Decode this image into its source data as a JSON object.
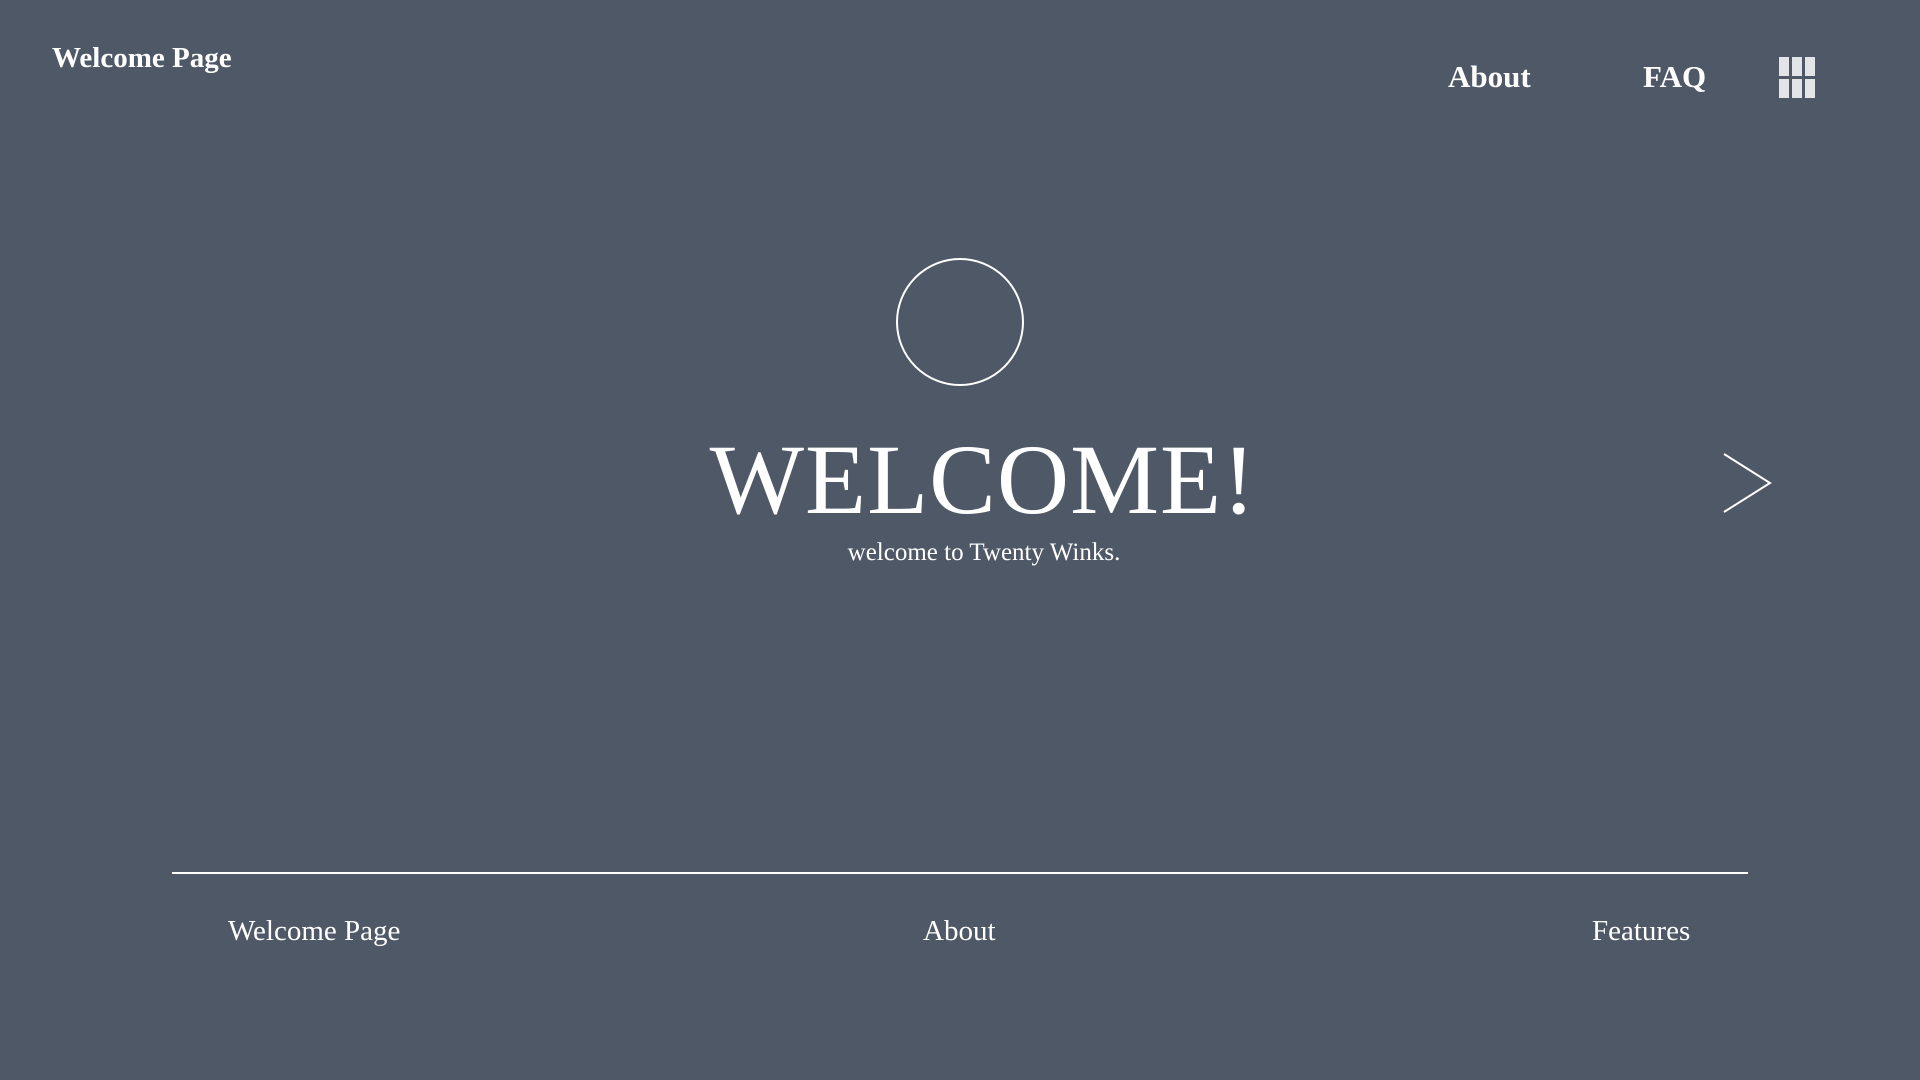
{
  "header": {
    "brand": "Welcome Page",
    "nav": [
      {
        "label": "About"
      },
      {
        "label": "FAQ"
      }
    ],
    "menu_icon": "grid-menu-icon"
  },
  "hero": {
    "avatar_icon": "circle-outline-icon",
    "title": "WELCOME!",
    "subtitle": "welcome to Twenty Winks.",
    "next_icon": "chevron-right-icon"
  },
  "footer": {
    "links": [
      {
        "label": "Welcome Page"
      },
      {
        "label": "About"
      },
      {
        "label": "Features"
      }
    ]
  },
  "colors": {
    "background": "#4f5866",
    "foreground": "#ffffff",
    "icon_fill": "#e2e4e8"
  }
}
